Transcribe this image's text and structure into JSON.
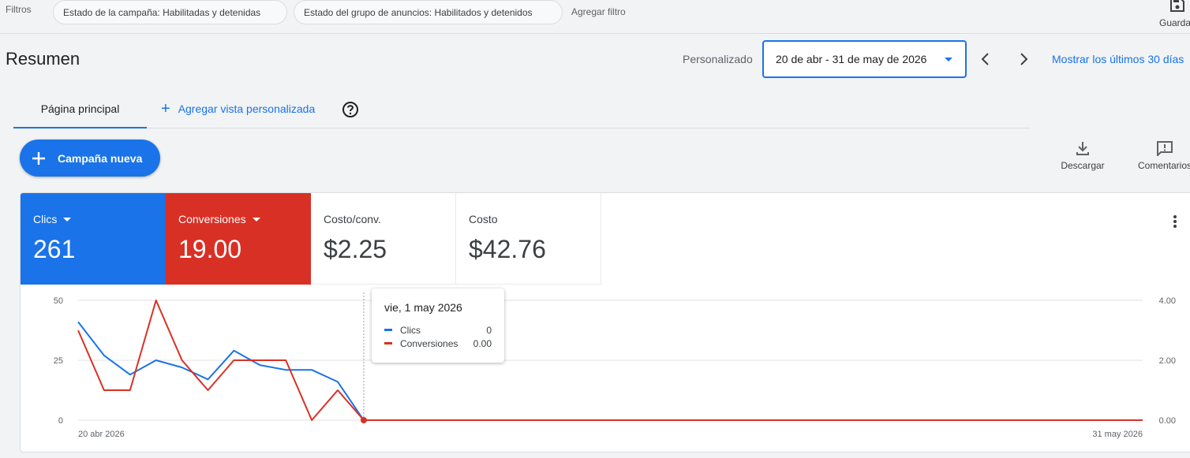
{
  "filters": {
    "label": "Filtros",
    "chips": [
      "Estado de la campaña: Habilitadas y detenidas",
      "Estado del grupo de anuncios: Habilitados y detenidos"
    ],
    "add_filter": "Agregar filtro",
    "save_label": "Guardar"
  },
  "header": {
    "title": "Resumen",
    "date_label": "Personalizado",
    "date_range": "20 de abr - 31 de may de 2026",
    "last_30": "Mostrar los últimos 30 días"
  },
  "tabs": {
    "main": "Página principal",
    "add_view": "Agregar vista personalizada"
  },
  "actions": {
    "new_campaign": "Campaña nueva",
    "download": "Descargar",
    "comments": "Comentarios"
  },
  "metrics": [
    {
      "label": "Clics",
      "value": "261",
      "color": "#1a73e8"
    },
    {
      "label": "Conversiones",
      "value": "19.00",
      "color": "#d93025"
    },
    {
      "label": "Costo/conv.",
      "value": "$2.25"
    },
    {
      "label": "Costo",
      "value": "$42.76"
    }
  ],
  "tooltip": {
    "title": "vie, 1 may 2026",
    "rows": [
      {
        "name": "Clics",
        "value": "0"
      },
      {
        "name": "Conversiones",
        "value": "0.00"
      }
    ]
  },
  "chart_data": {
    "type": "line",
    "x_labels": {
      "start": "20 abr 2026",
      "end": "31 may 2026"
    },
    "left_axis": {
      "ticks": [
        "50",
        "25",
        "0"
      ],
      "range": [
        0,
        50
      ]
    },
    "right_axis": {
      "ticks": [
        "4.00",
        "2.00",
        "0.00"
      ],
      "range": [
        0,
        4
      ]
    },
    "days": 42,
    "grid": true,
    "series": [
      {
        "name": "Clics",
        "axis": "left",
        "color": "#1a73e8",
        "values": [
          41,
          27,
          19,
          25,
          22,
          17,
          29,
          23,
          21,
          21,
          16,
          0,
          0,
          0,
          0,
          0,
          0,
          0,
          0,
          0,
          0,
          0,
          0,
          0,
          0,
          0,
          0,
          0,
          0,
          0,
          0,
          0,
          0,
          0,
          0,
          0,
          0,
          0,
          0,
          0,
          0,
          0
        ]
      },
      {
        "name": "Conversiones",
        "axis": "right",
        "color": "#d93025",
        "values": [
          3,
          1,
          1,
          4,
          2,
          1,
          2,
          2,
          2,
          0,
          1,
          0,
          0,
          0,
          0,
          0,
          0,
          0,
          0,
          0,
          0,
          0,
          0,
          0,
          0,
          0,
          0,
          0,
          0,
          0,
          0,
          0,
          0,
          0,
          0,
          0,
          0,
          0,
          0,
          0,
          0,
          0
        ]
      }
    ],
    "highlight_index": 11
  }
}
